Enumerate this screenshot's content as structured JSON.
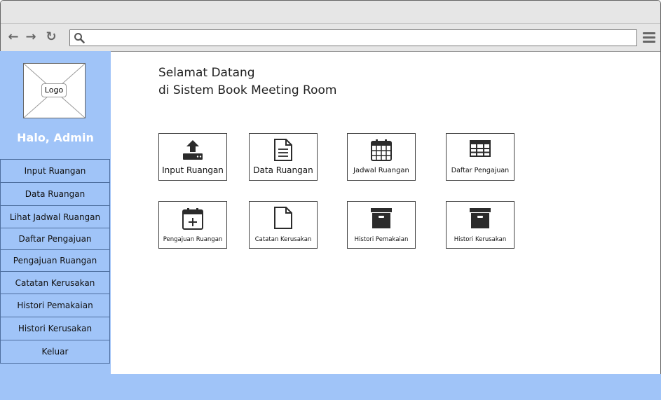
{
  "sidebar": {
    "logo_label": "Logo",
    "greeting": "Halo, Admin",
    "items": [
      {
        "label": "Input Ruangan"
      },
      {
        "label": "Data Ruangan"
      },
      {
        "label": "Lihat Jadwal Ruangan"
      },
      {
        "label": "Daftar Pengajuan"
      },
      {
        "label": "Pengajuan Ruangan"
      },
      {
        "label": "Catatan Kerusakan"
      },
      {
        "label": "Histori Pemakaian"
      },
      {
        "label": "Histori Kerusakan"
      },
      {
        "label": "Keluar"
      }
    ]
  },
  "main": {
    "welcome_line1": "Selamat Datang",
    "welcome_line2": "di Sistem Book Meeting Room",
    "tiles": [
      {
        "label": "Input Ruangan",
        "icon": "upload-icon"
      },
      {
        "label": "Data Ruangan",
        "icon": "document-icon"
      },
      {
        "label": "Jadwal Ruangan",
        "icon": "calendar-icon"
      },
      {
        "label": "Daftar Pengajuan",
        "icon": "table-icon"
      },
      {
        "label": "Pengajuan Ruangan",
        "icon": "calendar-plus-icon"
      },
      {
        "label": "Catatan Kerusakan",
        "icon": "blank-file-icon"
      },
      {
        "label": "Histori Pemakaian",
        "icon": "archive-icon"
      },
      {
        "label": "Histori Kerusakan",
        "icon": "archive-icon"
      }
    ]
  },
  "colors": {
    "sidebar_bg": "#a0c4f8",
    "sidebar_border": "#4d6e9e",
    "icon_dark": "#2b2b2b"
  }
}
